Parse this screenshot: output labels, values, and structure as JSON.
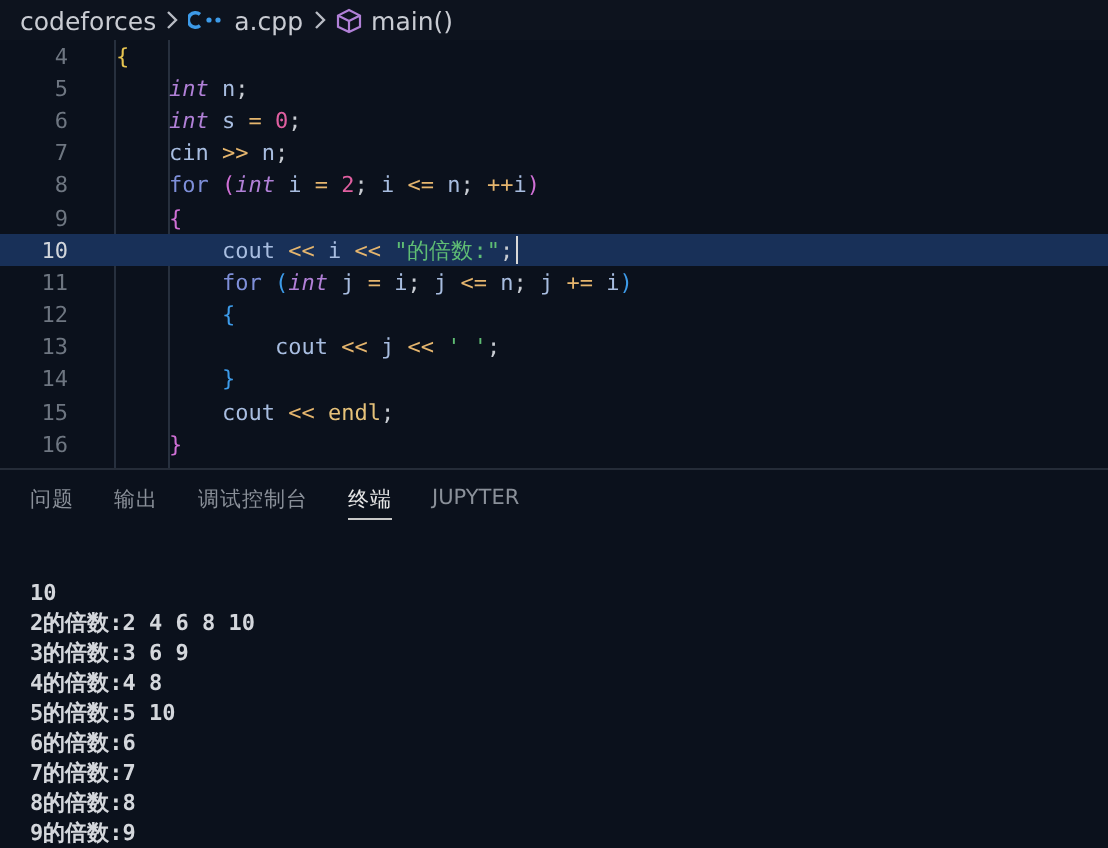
{
  "breadcrumb": {
    "folder": "codeforces",
    "file": "a.cpp",
    "symbol": "main()"
  },
  "editor": {
    "lines": [
      {
        "number": "4",
        "selected": false,
        "tokens": [
          {
            "kind": "b1",
            "text": "{"
          }
        ]
      },
      {
        "number": "5",
        "selected": false,
        "tokens": [
          {
            "kind": "type",
            "text": "    int"
          },
          {
            "kind": "id",
            "text": " n"
          },
          {
            "kind": "p",
            "text": ";"
          }
        ]
      },
      {
        "number": "6",
        "selected": false,
        "tokens": [
          {
            "kind": "type",
            "text": "    int"
          },
          {
            "kind": "id",
            "text": " s "
          },
          {
            "kind": "op",
            "text": "="
          },
          {
            "kind": "num",
            "text": " 0"
          },
          {
            "kind": "p",
            "text": ";"
          }
        ]
      },
      {
        "number": "7",
        "selected": false,
        "tokens": [
          {
            "kind": "id",
            "text": "    cin "
          },
          {
            "kind": "op",
            "text": ">>"
          },
          {
            "kind": "id",
            "text": " n"
          },
          {
            "kind": "p",
            "text": ";"
          }
        ]
      },
      {
        "number": "8",
        "selected": false,
        "tokens": [
          {
            "kind": "kw",
            "text": "    for "
          },
          {
            "kind": "b2",
            "text": "("
          },
          {
            "kind": "type",
            "text": "int"
          },
          {
            "kind": "id",
            "text": " i "
          },
          {
            "kind": "op",
            "text": "="
          },
          {
            "kind": "num",
            "text": " 2"
          },
          {
            "kind": "p",
            "text": ";"
          },
          {
            "kind": "id",
            "text": " i "
          },
          {
            "kind": "op",
            "text": "<="
          },
          {
            "kind": "id",
            "text": " n"
          },
          {
            "kind": "p",
            "text": "; "
          },
          {
            "kind": "op",
            "text": "++"
          },
          {
            "kind": "id",
            "text": "i"
          },
          {
            "kind": "b2",
            "text": ")"
          }
        ]
      },
      {
        "number": "9",
        "selected": false,
        "tokens": [
          {
            "kind": "b2",
            "text": "    {"
          }
        ]
      },
      {
        "number": "10",
        "selected": true,
        "tokens": [
          {
            "kind": "id",
            "text": "        cout "
          },
          {
            "kind": "op",
            "text": "<<"
          },
          {
            "kind": "id",
            "text": " i "
          },
          {
            "kind": "op",
            "text": "<<"
          },
          {
            "kind": "str",
            "text": " \"的倍数:\""
          },
          {
            "kind": "p",
            "text": ";"
          }
        ]
      },
      {
        "number": "11",
        "selected": false,
        "tokens": [
          {
            "kind": "kw",
            "text": "        for "
          },
          {
            "kind": "b3",
            "text": "("
          },
          {
            "kind": "type",
            "text": "int"
          },
          {
            "kind": "id",
            "text": " j "
          },
          {
            "kind": "op",
            "text": "="
          },
          {
            "kind": "id",
            "text": " i"
          },
          {
            "kind": "p",
            "text": ";"
          },
          {
            "kind": "id",
            "text": " j "
          },
          {
            "kind": "op",
            "text": "<="
          },
          {
            "kind": "id",
            "text": " n"
          },
          {
            "kind": "p",
            "text": ";"
          },
          {
            "kind": "id",
            "text": " j "
          },
          {
            "kind": "op",
            "text": "+="
          },
          {
            "kind": "id",
            "text": " i"
          },
          {
            "kind": "b3",
            "text": ")"
          }
        ]
      },
      {
        "number": "12",
        "selected": false,
        "tokens": [
          {
            "kind": "b3",
            "text": "        {"
          }
        ]
      },
      {
        "number": "13",
        "selected": false,
        "tokens": [
          {
            "kind": "id",
            "text": "            cout "
          },
          {
            "kind": "op",
            "text": "<<"
          },
          {
            "kind": "id",
            "text": " j "
          },
          {
            "kind": "op",
            "text": "<<"
          },
          {
            "kind": "str",
            "text": " ' '"
          },
          {
            "kind": "p",
            "text": ";"
          }
        ]
      },
      {
        "number": "14",
        "selected": false,
        "tokens": [
          {
            "kind": "b3",
            "text": "        }"
          }
        ]
      },
      {
        "number": "15",
        "selected": false,
        "tokens": [
          {
            "kind": "id",
            "text": "        cout "
          },
          {
            "kind": "op",
            "text": "<<"
          },
          {
            "kind": "fn",
            "text": " endl"
          },
          {
            "kind": "p",
            "text": ";"
          }
        ]
      },
      {
        "number": "16",
        "selected": false,
        "tokens": [
          {
            "kind": "b2",
            "text": "    }"
          }
        ]
      }
    ]
  },
  "panel": {
    "tabs": [
      {
        "label": "问题",
        "selected": false
      },
      {
        "label": "输出",
        "selected": false
      },
      {
        "label": "调试控制台",
        "selected": false
      },
      {
        "label": "终端",
        "selected": true
      },
      {
        "label": "JUPYTER",
        "selected": false
      }
    ],
    "terminal_lines": [
      "10",
      "2的倍数:2 4 6 8 10",
      "3的倍数:3 6 9",
      "4的倍数:4 8",
      "5的倍数:5 10",
      "6的倍数:6",
      "7的倍数:7",
      "8的倍数:8",
      "9的倍数:9"
    ]
  }
}
